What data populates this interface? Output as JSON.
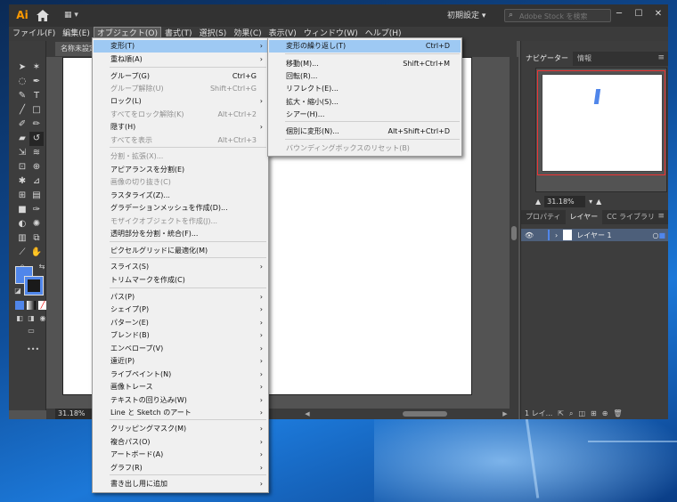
{
  "window": {
    "app_logo": "Ai",
    "workspace_label": "初期設定",
    "stock_search_placeholder": "Adobe Stock を検索",
    "minimize": "─",
    "maximize": "☐",
    "close": "✕"
  },
  "menubar": {
    "items": [
      "ファイル(F)",
      "編集(E)",
      "オブジェクト(O)",
      "書式(T)",
      "選択(S)",
      "効果(C)",
      "表示(V)",
      "ウィンドウ(W)",
      "ヘルプ(H)"
    ]
  },
  "document": {
    "tab_title": "名称未設定",
    "zoom": "31.18%"
  },
  "panels": {
    "top_tabs": [
      "ナビゲーター",
      "情報"
    ],
    "navigator_zoom": "31.18%",
    "bottom_tabs": [
      "プロパティ",
      "レイヤー",
      "CC ライブラリ"
    ],
    "layer_name": "レイヤー 1",
    "layer_count": "1 レイ..."
  },
  "object_menu": {
    "items": [
      {
        "label": "変形(T)",
        "shortcut": "",
        "submenu": true,
        "disabled": false,
        "highlighted": true
      },
      {
        "label": "重ね順(A)",
        "shortcut": "",
        "submenu": true,
        "disabled": false
      },
      {
        "label": "グループ(G)",
        "shortcut": "Ctrl+G",
        "submenu": false,
        "disabled": false
      },
      {
        "label": "グループ解除(U)",
        "shortcut": "Shift+Ctrl+G",
        "submenu": false,
        "disabled": true
      },
      {
        "label": "ロック(L)",
        "shortcut": "",
        "submenu": true,
        "disabled": false
      },
      {
        "label": "すべてをロック解除(K)",
        "shortcut": "Alt+Ctrl+2",
        "submenu": false,
        "disabled": true
      },
      {
        "label": "隠す(H)",
        "shortcut": "",
        "submenu": true,
        "disabled": false
      },
      {
        "label": "すべてを表示",
        "shortcut": "Alt+Ctrl+3",
        "submenu": false,
        "disabled": true
      },
      {
        "label": "分割・拡張(X)...",
        "shortcut": "",
        "submenu": false,
        "disabled": true
      },
      {
        "label": "アピアランスを分割(E)",
        "shortcut": "",
        "submenu": false,
        "disabled": false
      },
      {
        "label": "画像の切り抜き(C)",
        "shortcut": "",
        "submenu": false,
        "disabled": true
      },
      {
        "label": "ラスタライズ(Z)...",
        "shortcut": "",
        "submenu": false,
        "disabled": false
      },
      {
        "label": "グラデーションメッシュを作成(D)...",
        "shortcut": "",
        "submenu": false,
        "disabled": false
      },
      {
        "label": "モザイクオブジェクトを作成(J)...",
        "shortcut": "",
        "submenu": false,
        "disabled": true
      },
      {
        "label": "透明部分を分割・統合(F)...",
        "shortcut": "",
        "submenu": false,
        "disabled": false
      },
      {
        "label": "ピクセルグリッドに最適化(M)",
        "shortcut": "",
        "submenu": false,
        "disabled": false
      },
      {
        "label": "スライス(S)",
        "shortcut": "",
        "submenu": true,
        "disabled": false
      },
      {
        "label": "トリムマークを作成(C)",
        "shortcut": "",
        "submenu": false,
        "disabled": false
      },
      {
        "label": "パス(P)",
        "shortcut": "",
        "submenu": true,
        "disabled": false
      },
      {
        "label": "シェイプ(P)",
        "shortcut": "",
        "submenu": true,
        "disabled": false
      },
      {
        "label": "パターン(E)",
        "shortcut": "",
        "submenu": true,
        "disabled": false
      },
      {
        "label": "ブレンド(B)",
        "shortcut": "",
        "submenu": true,
        "disabled": false
      },
      {
        "label": "エンベロープ(V)",
        "shortcut": "",
        "submenu": true,
        "disabled": false
      },
      {
        "label": "遠近(P)",
        "shortcut": "",
        "submenu": true,
        "disabled": false
      },
      {
        "label": "ライブペイント(N)",
        "shortcut": "",
        "submenu": true,
        "disabled": false
      },
      {
        "label": "画像トレース",
        "shortcut": "",
        "submenu": true,
        "disabled": false
      },
      {
        "label": "テキストの回り込み(W)",
        "shortcut": "",
        "submenu": true,
        "disabled": false
      },
      {
        "label": "Line と Sketch のアート",
        "shortcut": "",
        "submenu": true,
        "disabled": false
      },
      {
        "label": "クリッピングマスク(M)",
        "shortcut": "",
        "submenu": true,
        "disabled": false
      },
      {
        "label": "複合パス(O)",
        "shortcut": "",
        "submenu": true,
        "disabled": false
      },
      {
        "label": "アートボード(A)",
        "shortcut": "",
        "submenu": true,
        "disabled": false
      },
      {
        "label": "グラフ(R)",
        "shortcut": "",
        "submenu": true,
        "disabled": false
      },
      {
        "label": "書き出し用に追加",
        "shortcut": "",
        "submenu": true,
        "disabled": false
      }
    ]
  },
  "transform_submenu": {
    "items": [
      {
        "label": "変形の繰り返し(T)",
        "shortcut": "Ctrl+D",
        "disabled": false,
        "highlighted": true
      },
      {
        "label": "移動(M)...",
        "shortcut": "Shift+Ctrl+M",
        "disabled": false
      },
      {
        "label": "回転(R)...",
        "shortcut": "",
        "disabled": false
      },
      {
        "label": "リフレクト(E)...",
        "shortcut": "",
        "disabled": false
      },
      {
        "label": "拡大・縮小(S)...",
        "shortcut": "",
        "disabled": false
      },
      {
        "label": "シアー(H)...",
        "shortcut": "",
        "disabled": false
      },
      {
        "label": "個別に変形(N)...",
        "shortcut": "Alt+Shift+Ctrl+D",
        "disabled": false
      },
      {
        "label": "バウンディングボックスのリセット(B)",
        "shortcut": "",
        "disabled": true
      }
    ]
  },
  "colors": {
    "fill": "#5086ea",
    "menu_highlight": "#9ec9f3",
    "app_accent": "#ff9a00"
  }
}
